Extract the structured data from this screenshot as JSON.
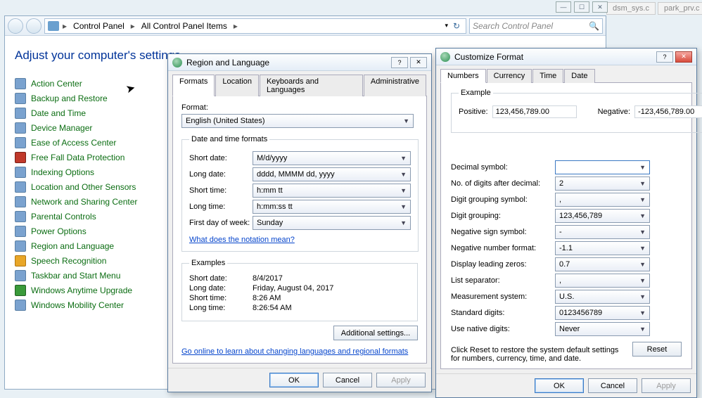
{
  "bg_tabs": {
    "dsm": "dsm_sys.c",
    "park": "park_prv.c"
  },
  "explorer": {
    "breadcrumb": [
      "Control Panel",
      "All Control Panel Items"
    ],
    "search_placeholder": "Search Control Panel",
    "heading": "Adjust your computer's settings",
    "col1": [
      "Action Center",
      "Backup and Restore",
      "Date and Time",
      "Device Manager",
      "Ease of Access Center",
      "Free Fall Data Protection",
      "Indexing Options",
      "Location and Other Sensors",
      "Network and Sharing Center",
      "Parental Controls",
      "Power Options",
      "Region and Language",
      "Speech Recognition",
      "Taskbar and Start Menu",
      "Windows Anytime Upgrade",
      "Windows Mobility Center"
    ]
  },
  "region_dialog": {
    "title": "Region and Language",
    "tabs": [
      "Formats",
      "Location",
      "Keyboards and Languages",
      "Administrative"
    ],
    "format_label": "Format:",
    "format_value": "English (United States)",
    "dt_group": "Date and time formats",
    "rows": {
      "short_date": {
        "label": "Short date:",
        "value": "M/d/yyyy"
      },
      "long_date": {
        "label": "Long date:",
        "value": "dddd, MMMM dd, yyyy"
      },
      "short_time": {
        "label": "Short time:",
        "value": "h:mm tt"
      },
      "long_time": {
        "label": "Long time:",
        "value": "h:mm:ss tt"
      },
      "first_day": {
        "label": "First day of week:",
        "value": "Sunday"
      }
    },
    "notation_link": "What does the notation mean?",
    "examples_group": "Examples",
    "examples": {
      "short_date": "8/4/2017",
      "long_date": "Friday, August 04, 2017",
      "short_time": "8:26 AM",
      "long_time": "8:26:54 AM"
    },
    "additional_btn": "Additional settings...",
    "online_link": "Go online to learn about changing languages and regional formats",
    "buttons": {
      "ok": "OK",
      "cancel": "Cancel",
      "apply": "Apply"
    }
  },
  "customize_dialog": {
    "title": "Customize Format",
    "tabs": [
      "Numbers",
      "Currency",
      "Time",
      "Date"
    ],
    "example_label": "Example",
    "positive_label": "Positive:",
    "positive_value": "123,456,789.00",
    "negative_label": "Negative:",
    "negative_value": "-123,456,789.00",
    "fields": {
      "decimal_symbol": {
        "label": "Decimal symbol:",
        "value": ""
      },
      "digits_after": {
        "label": "No. of digits after decimal:",
        "value": "2"
      },
      "grouping_symbol": {
        "label": "Digit grouping symbol:",
        "value": ","
      },
      "grouping": {
        "label": "Digit grouping:",
        "value": "123,456,789"
      },
      "neg_sign": {
        "label": "Negative sign symbol:",
        "value": "-"
      },
      "neg_format": {
        "label": "Negative number format:",
        "value": "-1.1"
      },
      "leading_zeros": {
        "label": "Display leading zeros:",
        "value": "0.7"
      },
      "list_sep": {
        "label": "List separator:",
        "value": ","
      },
      "measurement": {
        "label": "Measurement system:",
        "value": "U.S."
      },
      "std_digits": {
        "label": "Standard digits:",
        "value": "0123456789"
      },
      "native_digits": {
        "label": "Use native digits:",
        "value": "Never"
      }
    },
    "reset_hint": "Click Reset to restore the system default settings for numbers, currency, time, and date.",
    "reset_btn": "Reset",
    "buttons": {
      "ok": "OK",
      "cancel": "Cancel",
      "apply": "Apply"
    }
  }
}
